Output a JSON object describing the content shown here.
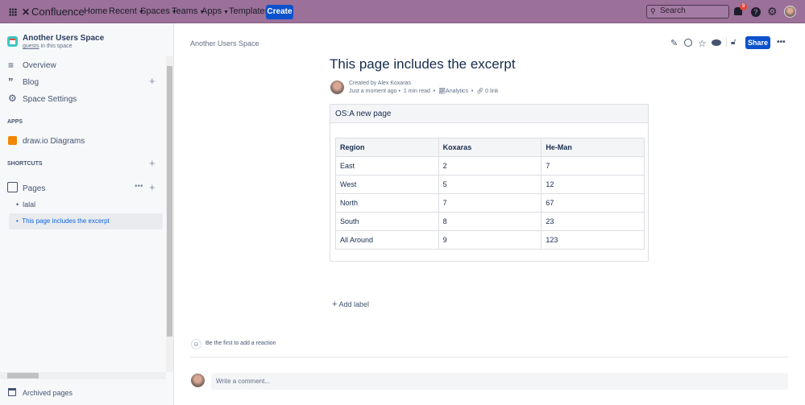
{
  "topbar": {
    "product": "Confluence",
    "nav": [
      "Home",
      "Recent",
      "Spaces",
      "Teams",
      "Apps",
      "Templates"
    ],
    "create": "Create",
    "search_placeholder": "Search",
    "notification_count": "9"
  },
  "sidebar": {
    "space_name": "Another Users Space",
    "guests_link": "guests",
    "guests_suffix": " in this space",
    "overview": "Overview",
    "blog": "Blog",
    "settings": "Space Settings",
    "apps_heading": "APPS",
    "drawio": "draw.io Diagrams",
    "shortcuts_heading": "SHORTCUTS",
    "pages": "Pages",
    "tree": [
      "lalal",
      "This page includes the excerpt"
    ],
    "archived": "Archived pages"
  },
  "page": {
    "breadcrumb": "Another Users Space",
    "share": "Share",
    "title": "This page includes the excerpt",
    "created_by": "Created by Alex Koxaras",
    "time": "Just a moment ago",
    "read": "1 min read",
    "analytics": "Analytics",
    "links": "0 link",
    "excerpt_title": "OS:A new page",
    "table": {
      "headers": [
        "Region",
        "Koxaras",
        "He-Man"
      ],
      "rows": [
        [
          "East",
          "2",
          "7"
        ],
        [
          "West",
          "5",
          "12"
        ],
        [
          "North",
          "7",
          "67"
        ],
        [
          "South",
          "8",
          "23"
        ],
        [
          "All Around",
          "9",
          "123"
        ]
      ]
    },
    "add_label": "Add label",
    "reaction": "Be the first to add a reaction",
    "comment_placeholder": "Write a comment..."
  }
}
